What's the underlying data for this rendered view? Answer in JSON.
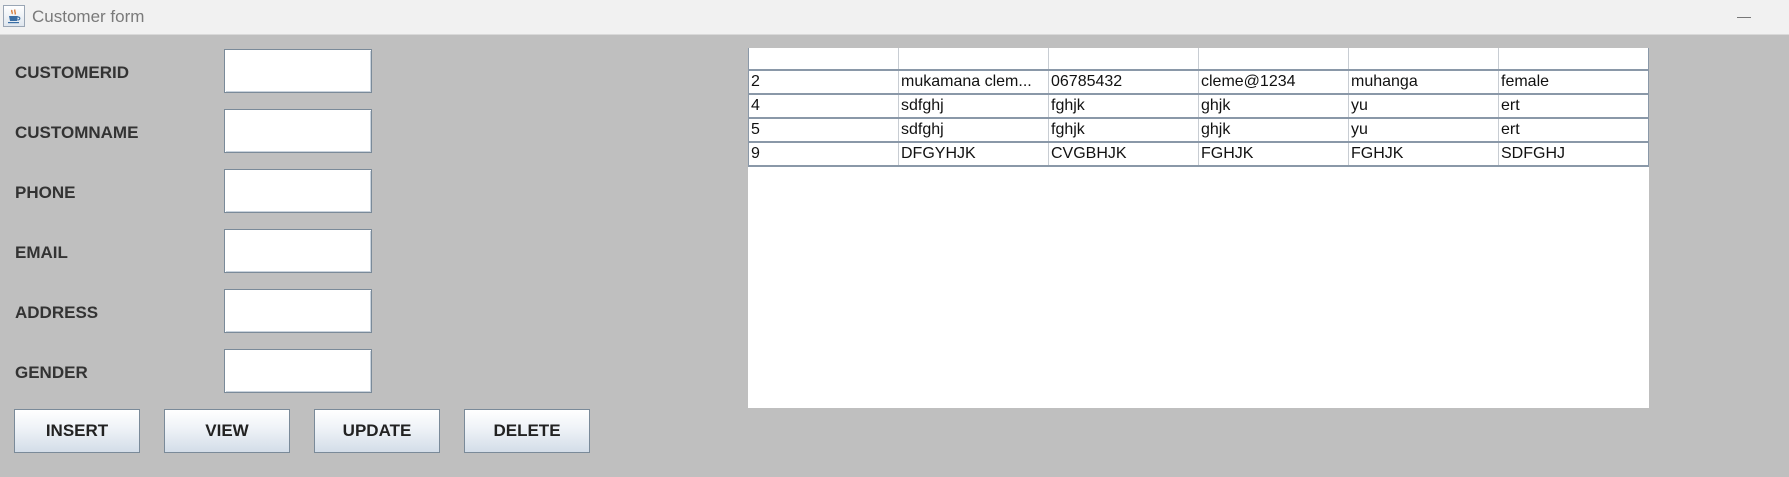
{
  "window": {
    "title": "Customer form"
  },
  "form": {
    "fields": [
      {
        "label": "CUSTOMERID",
        "value": ""
      },
      {
        "label": "CUSTOMNAME",
        "value": ""
      },
      {
        "label": "PHONE",
        "value": ""
      },
      {
        "label": "EMAIL",
        "value": ""
      },
      {
        "label": "ADDRESS",
        "value": ""
      },
      {
        "label": "GENDER",
        "value": ""
      }
    ]
  },
  "buttons": {
    "insert": "INSERT",
    "view": "VIEW",
    "update": "UPDATE",
    "delete": "DELETE"
  },
  "table": {
    "headers": [
      "",
      "",
      "",
      "",
      "",
      ""
    ],
    "rows": [
      [
        "2",
        "mukamana clem...",
        "06785432",
        "cleme@1234",
        "muhanga",
        "female"
      ],
      [
        "4",
        "sdfghj",
        "fghjk",
        "ghjk",
        "yu",
        "ert"
      ],
      [
        "5",
        "sdfghj",
        "fghjk",
        "ghjk",
        "yu",
        "ert"
      ],
      [
        "9",
        "DFGYHJK",
        "CVGBHJK",
        "FGHJK",
        "FGHJK",
        "SDFGHJ"
      ]
    ]
  },
  "icons": {
    "app": "java-cup-icon",
    "minimize": "minimize-icon"
  }
}
